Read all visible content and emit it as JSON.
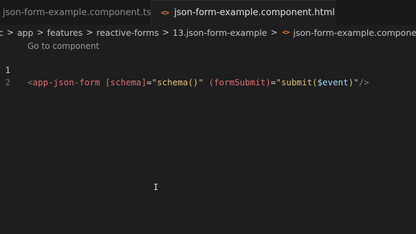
{
  "tabs": [
    {
      "label": "json-form-example.component.ts",
      "active": false,
      "icon": "typescript-file-icon"
    },
    {
      "label": "json-form-example.component.html",
      "active": true,
      "icon": "html-file-icon",
      "icon_glyph": "<>",
      "close_glyph": "✕"
    }
  ],
  "breadcrumb": {
    "items": [
      "c",
      "app",
      "features",
      "reactive-forms",
      "13.json-form-example",
      "json-form-example.component.html"
    ],
    "file_icon_glyph": "<>",
    "symbol_icon_glyph": "<>",
    "separator": ">"
  },
  "editor": {
    "codelens": "Go to component",
    "line_numbers": [
      "1",
      "2"
    ],
    "line1": {
      "open": "<",
      "tag": "app-json-form",
      "attr1": "[schema]",
      "eq1": "=",
      "q1": "\"",
      "val1": "schema()",
      "q2": "\"",
      "attr2": "(formSubmit)",
      "eq2": "=",
      "q3": "\"",
      "fn2": "submit(",
      "arg2": "$event",
      "close_paren": ")",
      "q4": "\"",
      "selfclose": "/>"
    },
    "mouse_cursor_glyph": "I"
  },
  "colors": {
    "editor_bg": "#1e1e1e",
    "tag": "#e06c75",
    "string": "#e5c07b",
    "variable": "#9cdcfe",
    "html_icon": "#e37933"
  }
}
